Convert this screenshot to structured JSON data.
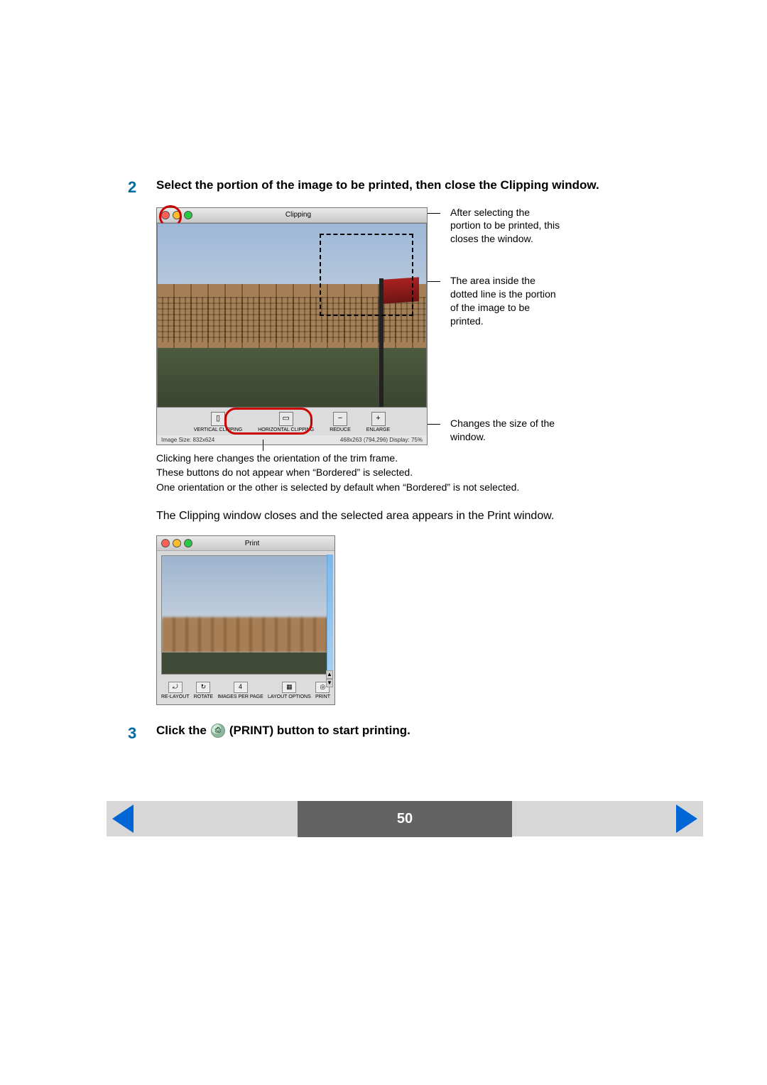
{
  "step2": {
    "number": "2",
    "heading": "Select the portion of the image to be printed, then close the Clipping window."
  },
  "clipping": {
    "title": "Clipping",
    "toolbar": {
      "vertical": {
        "glyph": "▯",
        "label": "VERTICAL CLIPPING"
      },
      "horizontal": {
        "glyph": "▭",
        "label": "HORIZONTAL CLIPPING"
      },
      "reduce": {
        "glyph": "−",
        "label": "REDUCE"
      },
      "enlarge": {
        "glyph": "+",
        "label": "ENLARGE"
      }
    },
    "status": {
      "left": "Image Size:    832x624",
      "right": "468x263 (794,296)  Display:    75%"
    }
  },
  "callouts": {
    "close": "After selecting the portion to be printed, this closes the window.",
    "dotted": "The area inside the dotted line is the portion of the image to be printed.",
    "zoom": "Changes the size of the window."
  },
  "orientation_notes": {
    "l1": "Clicking here changes the orientation of the trim frame.",
    "l2": "These buttons do not appear when “Bordered” is selected.",
    "l3": "One orientation or the other is selected by default when “Bordered” is not selected."
  },
  "closing_line": "The Clipping window closes and the selected area appears in the Print window.",
  "print": {
    "title": "Print",
    "toolbar": {
      "relayout": "RE-LAYOUT",
      "rotate": "ROTATE",
      "images_count": "4",
      "images": "IMAGES PER PAGE",
      "layout": "LAYOUT OPTIONS",
      "print": "PRINT"
    }
  },
  "step3": {
    "number": "3",
    "before": "Click the ",
    "after": " (PRINT) button to start printing."
  },
  "page_number": "50"
}
